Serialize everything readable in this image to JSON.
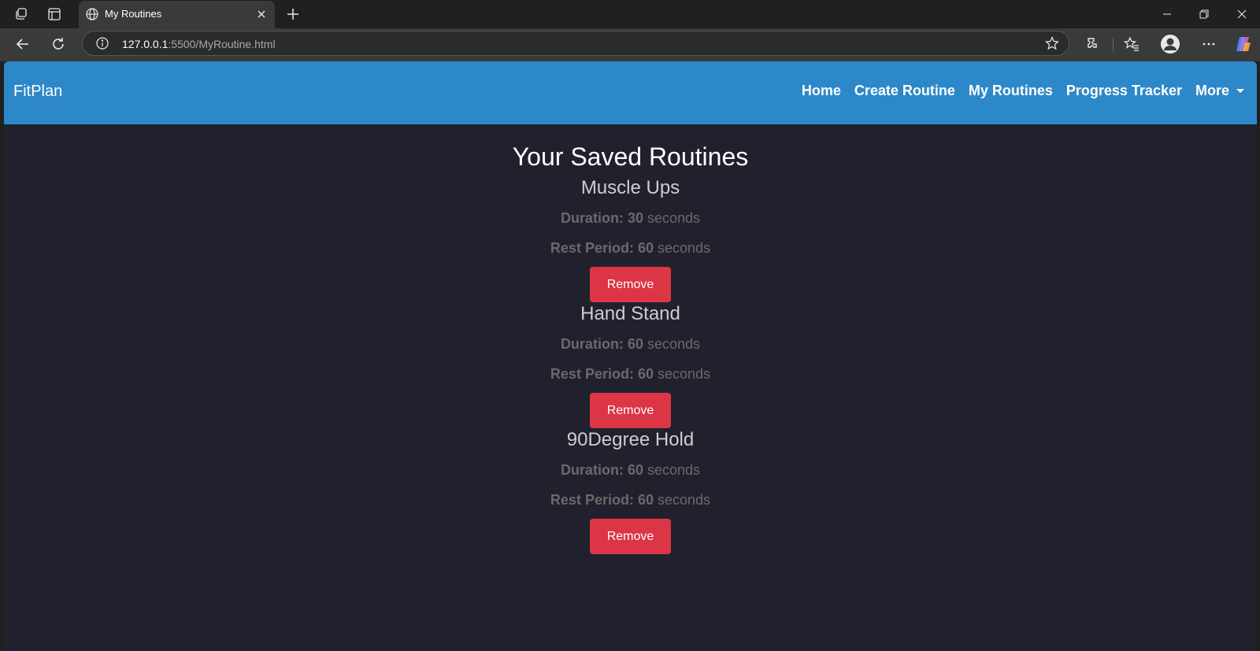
{
  "browser": {
    "tab_title": "My Routines",
    "url_host": "127.0.0.1",
    "url_rest": ":5500/MyRoutine.html"
  },
  "navbar": {
    "brand": "FitPlan",
    "links": [
      "Home",
      "Create Routine",
      "My Routines",
      "Progress Tracker"
    ],
    "more_label": "More",
    "color": "#2c88c9"
  },
  "page": {
    "title": "Your Saved Routines",
    "background": "#21212e"
  },
  "labels": {
    "duration": "Duration:",
    "rest": "Rest Period:",
    "unit": "seconds",
    "remove": "Remove"
  },
  "routines": [
    {
      "name": "Muscle Ups",
      "duration": "30",
      "rest": "60"
    },
    {
      "name": "Hand Stand",
      "duration": "60",
      "rest": "60"
    },
    {
      "name": "90Degree Hold",
      "duration": "60",
      "rest": "60"
    }
  ],
  "colors": {
    "remove_button": "#dc3545"
  }
}
